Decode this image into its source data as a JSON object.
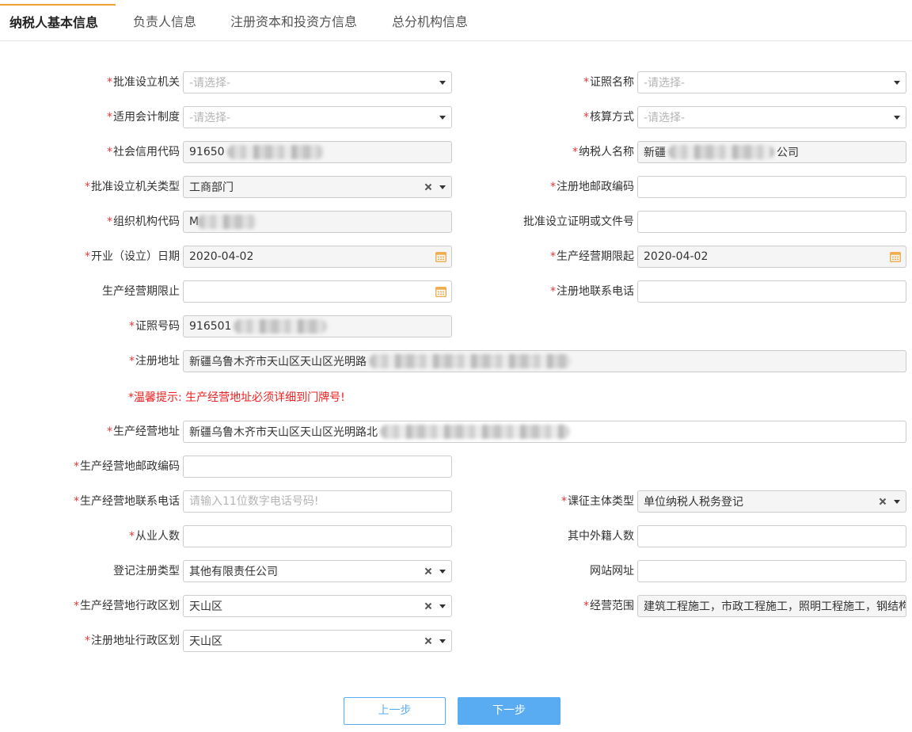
{
  "tabs": {
    "basic": "纳税人基本信息",
    "principal": "负责人信息",
    "capital": "注册资本和投资方信息",
    "branch": "总分机构信息"
  },
  "ui": {
    "required_mark": "*"
  },
  "form": {
    "approval_authority": {
      "label": "批准设立机关",
      "placeholder": "-请选择-"
    },
    "license_name": {
      "label": "证照名称",
      "placeholder": "-请选择-"
    },
    "accounting_system": {
      "label": "适用会计制度",
      "placeholder": "-请选择-"
    },
    "accounting_method": {
      "label": "核算方式",
      "placeholder": "-请选择-"
    },
    "credit_code": {
      "label": "社会信用代码",
      "value": "91650"
    },
    "taxpayer_name": {
      "label": "纳税人名称",
      "value_prefix": "新疆",
      "value_suffix": "公司"
    },
    "approval_authority_type": {
      "label": "批准设立机关类型",
      "value": "工商部门"
    },
    "reg_postcode": {
      "label": "注册地邮政编码",
      "value": ""
    },
    "org_code": {
      "label": "组织机构代码",
      "value": "M"
    },
    "approval_doc_no": {
      "label": "批准设立证明或文件号",
      "value": ""
    },
    "open_date": {
      "label": "开业（设立）日期",
      "value": "2020-04-02"
    },
    "period_start": {
      "label": "生产经营期限起",
      "value": "2020-04-02"
    },
    "period_end": {
      "label": "生产经营期限止",
      "value": ""
    },
    "reg_phone": {
      "label": "注册地联系电话",
      "value": ""
    },
    "license_no": {
      "label": "证照号码",
      "value": "916501"
    },
    "reg_address": {
      "label": "注册地址",
      "value": "新疆乌鲁木齐市天山区天山区光明路"
    },
    "biz_address": {
      "label": "生产经营地址",
      "value": "新疆乌鲁木齐市天山区天山区光明路北"
    },
    "biz_postcode": {
      "label": "生产经营地邮政编码",
      "value": ""
    },
    "biz_phone": {
      "label": "生产经营地联系电话",
      "placeholder": "请输入11位数字电话号码!"
    },
    "levy_subject_type": {
      "label": "课征主体类型",
      "value": "单位纳税人税务登记"
    },
    "employees": {
      "label": "从业人数",
      "value": ""
    },
    "foreign_employees": {
      "label": "其中外籍人数",
      "value": ""
    },
    "reg_type": {
      "label": "登记注册类型",
      "value": "其他有限责任公司"
    },
    "website": {
      "label": "网站网址",
      "value": ""
    },
    "biz_division": {
      "label": "生产经营地行政区划",
      "value": "天山区"
    },
    "biz_scope": {
      "label": "经营范围",
      "value": "建筑工程施工，市政工程施工，照明工程施工，钢结构"
    },
    "reg_division": {
      "label": "注册地址行政区划",
      "value": "天山区"
    }
  },
  "notice": "*温馨提示: 生产经营地址必须详细到门牌号!",
  "buttons": {
    "prev": "上一步",
    "next": "下一步"
  },
  "colors": {
    "accent": "#f0a030",
    "required": "#e4393c",
    "notice": "#f02020",
    "border": "#cccccc",
    "readonly": "#f5f5f5",
    "calendar": "#f0ad4e",
    "primary": "#5aacf2",
    "placeholder": "#b4b4b4"
  },
  "icons": {
    "select_caret": "caret-down-icon",
    "clear_selection": "close-icon",
    "date_picker": "calendar-icon"
  }
}
